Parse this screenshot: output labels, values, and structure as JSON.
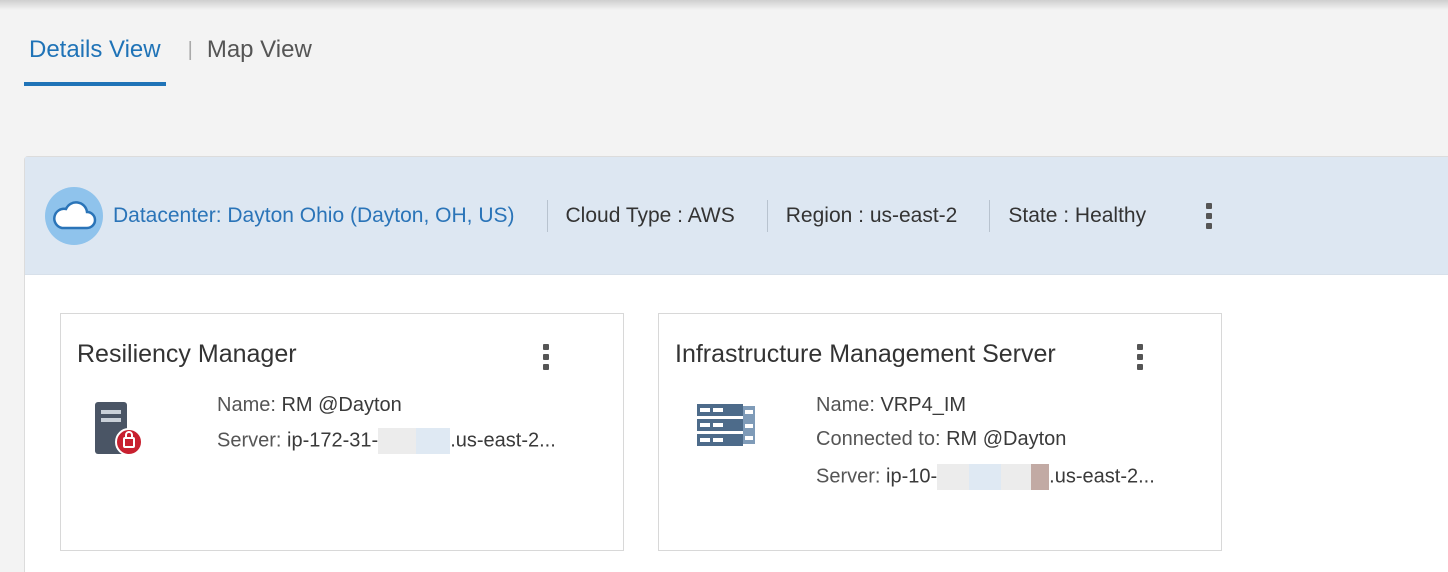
{
  "tabs": [
    {
      "label": "Details View",
      "active": true
    },
    {
      "label": "Map View",
      "active": false
    }
  ],
  "tab_separator": "|",
  "datacenter": {
    "icon": "cloud-icon",
    "name": "Datacenter: Dayton Ohio (Dayton, OH, US)",
    "cloud_type": "Cloud Type : AWS",
    "region": "Region : us-east-2",
    "state": "State : Healthy"
  },
  "cards": [
    {
      "title": "Resiliency Manager",
      "icon": "resiliency-manager-server-icon",
      "name_label": "Name:",
      "name_value": "RM @Dayton",
      "server_label": "Server:",
      "server_prefix": "ip-172-31-",
      "server_suffix": ".us-east-2..."
    },
    {
      "title": "Infrastructure Management Server",
      "icon": "server-rack-icon",
      "name_label": "Name:",
      "name_value": "VRP4_IM",
      "connected_label": "Connected to:",
      "connected_value": "RM @Dayton",
      "server_label": "Server:",
      "server_prefix": "ip-10-",
      "server_suffix": ".us-east-2..."
    }
  ],
  "colors": {
    "accent": "#1f73b7",
    "header_bg": "#dde7f2",
    "cloud_circle": "#8fc3ec",
    "badge_red": "#c8202f"
  }
}
